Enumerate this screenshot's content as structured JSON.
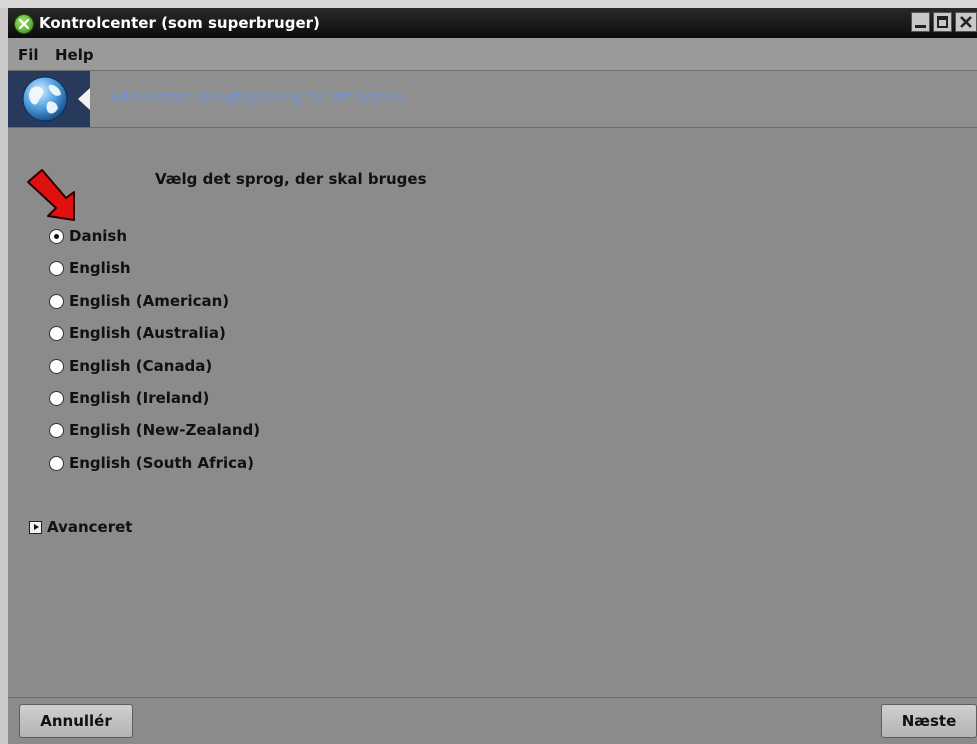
{
  "window": {
    "title": "Kontrolcenter (som superbruger)",
    "icon": "mageia-x-icon"
  },
  "menubar": {
    "file": "Fil",
    "help": "Help"
  },
  "banner": {
    "icon": "globe-icon",
    "text": "Administrer sprogtilpasning for dit system"
  },
  "main": {
    "heading": "Vælg det sprog, der skal bruges",
    "languages": [
      {
        "label": "Danish",
        "checked": true
      },
      {
        "label": "English",
        "checked": false
      },
      {
        "label": "English (American)",
        "checked": false
      },
      {
        "label": "English (Australia)",
        "checked": false
      },
      {
        "label": "English (Canada)",
        "checked": false
      },
      {
        "label": "English (Ireland)",
        "checked": false
      },
      {
        "label": "English (New-Zealand)",
        "checked": false
      },
      {
        "label": "English (South Africa)",
        "checked": false
      }
    ],
    "advanced_label": "Avanceret"
  },
  "footer": {
    "cancel_label": "Annullér",
    "next_label": "Næste"
  },
  "colors": {
    "window_bg": "#8b8b8b",
    "banner_text": "#6f95d6",
    "annotation_arrow": "#e01010"
  }
}
